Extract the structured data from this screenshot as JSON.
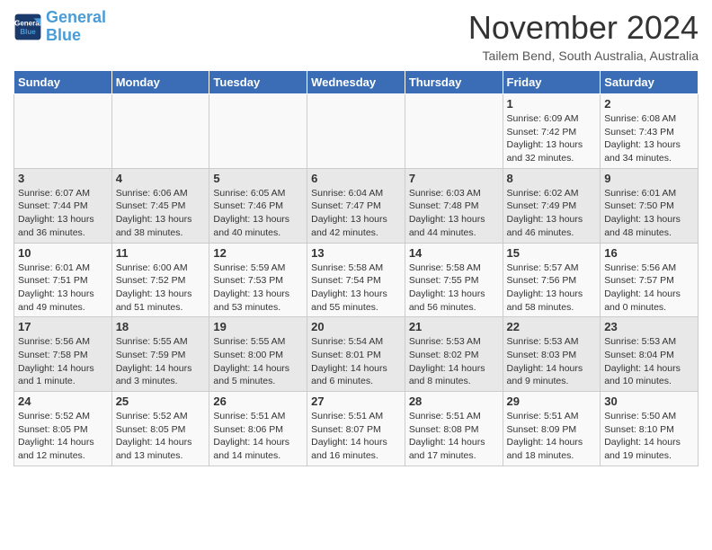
{
  "header": {
    "logo_line1": "General",
    "logo_line2": "Blue",
    "month": "November 2024",
    "location": "Tailem Bend, South Australia, Australia"
  },
  "weekdays": [
    "Sunday",
    "Monday",
    "Tuesday",
    "Wednesday",
    "Thursday",
    "Friday",
    "Saturday"
  ],
  "weeks": [
    [
      {
        "day": "",
        "info": ""
      },
      {
        "day": "",
        "info": ""
      },
      {
        "day": "",
        "info": ""
      },
      {
        "day": "",
        "info": ""
      },
      {
        "day": "",
        "info": ""
      },
      {
        "day": "1",
        "info": "Sunrise: 6:09 AM\nSunset: 7:42 PM\nDaylight: 13 hours\nand 32 minutes."
      },
      {
        "day": "2",
        "info": "Sunrise: 6:08 AM\nSunset: 7:43 PM\nDaylight: 13 hours\nand 34 minutes."
      }
    ],
    [
      {
        "day": "3",
        "info": "Sunrise: 6:07 AM\nSunset: 7:44 PM\nDaylight: 13 hours\nand 36 minutes."
      },
      {
        "day": "4",
        "info": "Sunrise: 6:06 AM\nSunset: 7:45 PM\nDaylight: 13 hours\nand 38 minutes."
      },
      {
        "day": "5",
        "info": "Sunrise: 6:05 AM\nSunset: 7:46 PM\nDaylight: 13 hours\nand 40 minutes."
      },
      {
        "day": "6",
        "info": "Sunrise: 6:04 AM\nSunset: 7:47 PM\nDaylight: 13 hours\nand 42 minutes."
      },
      {
        "day": "7",
        "info": "Sunrise: 6:03 AM\nSunset: 7:48 PM\nDaylight: 13 hours\nand 44 minutes."
      },
      {
        "day": "8",
        "info": "Sunrise: 6:02 AM\nSunset: 7:49 PM\nDaylight: 13 hours\nand 46 minutes."
      },
      {
        "day": "9",
        "info": "Sunrise: 6:01 AM\nSunset: 7:50 PM\nDaylight: 13 hours\nand 48 minutes."
      }
    ],
    [
      {
        "day": "10",
        "info": "Sunrise: 6:01 AM\nSunset: 7:51 PM\nDaylight: 13 hours\nand 49 minutes."
      },
      {
        "day": "11",
        "info": "Sunrise: 6:00 AM\nSunset: 7:52 PM\nDaylight: 13 hours\nand 51 minutes."
      },
      {
        "day": "12",
        "info": "Sunrise: 5:59 AM\nSunset: 7:53 PM\nDaylight: 13 hours\nand 53 minutes."
      },
      {
        "day": "13",
        "info": "Sunrise: 5:58 AM\nSunset: 7:54 PM\nDaylight: 13 hours\nand 55 minutes."
      },
      {
        "day": "14",
        "info": "Sunrise: 5:58 AM\nSunset: 7:55 PM\nDaylight: 13 hours\nand 56 minutes."
      },
      {
        "day": "15",
        "info": "Sunrise: 5:57 AM\nSunset: 7:56 PM\nDaylight: 13 hours\nand 58 minutes."
      },
      {
        "day": "16",
        "info": "Sunrise: 5:56 AM\nSunset: 7:57 PM\nDaylight: 14 hours\nand 0 minutes."
      }
    ],
    [
      {
        "day": "17",
        "info": "Sunrise: 5:56 AM\nSunset: 7:58 PM\nDaylight: 14 hours\nand 1 minute."
      },
      {
        "day": "18",
        "info": "Sunrise: 5:55 AM\nSunset: 7:59 PM\nDaylight: 14 hours\nand 3 minutes."
      },
      {
        "day": "19",
        "info": "Sunrise: 5:55 AM\nSunset: 8:00 PM\nDaylight: 14 hours\nand 5 minutes."
      },
      {
        "day": "20",
        "info": "Sunrise: 5:54 AM\nSunset: 8:01 PM\nDaylight: 14 hours\nand 6 minutes."
      },
      {
        "day": "21",
        "info": "Sunrise: 5:53 AM\nSunset: 8:02 PM\nDaylight: 14 hours\nand 8 minutes."
      },
      {
        "day": "22",
        "info": "Sunrise: 5:53 AM\nSunset: 8:03 PM\nDaylight: 14 hours\nand 9 minutes."
      },
      {
        "day": "23",
        "info": "Sunrise: 5:53 AM\nSunset: 8:04 PM\nDaylight: 14 hours\nand 10 minutes."
      }
    ],
    [
      {
        "day": "24",
        "info": "Sunrise: 5:52 AM\nSunset: 8:05 PM\nDaylight: 14 hours\nand 12 minutes."
      },
      {
        "day": "25",
        "info": "Sunrise: 5:52 AM\nSunset: 8:05 PM\nDaylight: 14 hours\nand 13 minutes."
      },
      {
        "day": "26",
        "info": "Sunrise: 5:51 AM\nSunset: 8:06 PM\nDaylight: 14 hours\nand 14 minutes."
      },
      {
        "day": "27",
        "info": "Sunrise: 5:51 AM\nSunset: 8:07 PM\nDaylight: 14 hours\nand 16 minutes."
      },
      {
        "day": "28",
        "info": "Sunrise: 5:51 AM\nSunset: 8:08 PM\nDaylight: 14 hours\nand 17 minutes."
      },
      {
        "day": "29",
        "info": "Sunrise: 5:51 AM\nSunset: 8:09 PM\nDaylight: 14 hours\nand 18 minutes."
      },
      {
        "day": "30",
        "info": "Sunrise: 5:50 AM\nSunset: 8:10 PM\nDaylight: 14 hours\nand 19 minutes."
      }
    ]
  ]
}
